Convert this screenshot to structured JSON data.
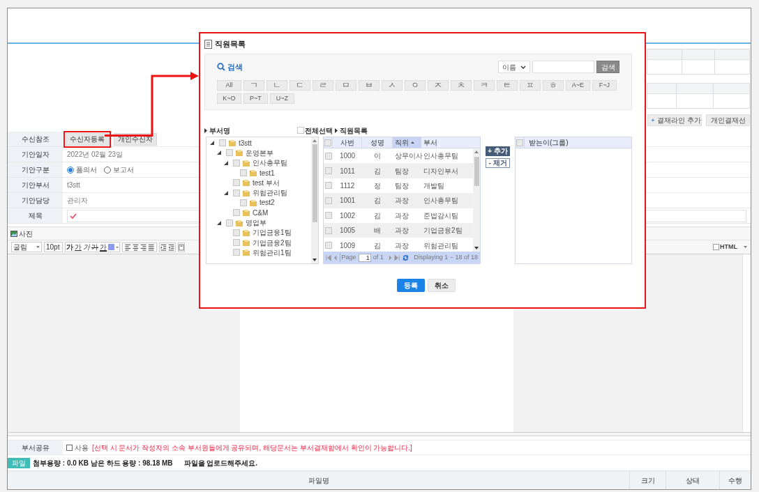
{
  "document": {
    "approval_buttons": [
      {
        "label": "결재라인 추가",
        "kind": "add"
      },
      {
        "label": "개인결재선",
        "kind": "plain"
      }
    ],
    "form_rows": [
      {
        "kind": "buttons",
        "label": "수신참조",
        "buttons": [
          {
            "label": "수신자등록",
            "highlighted": true
          },
          {
            "label": "개인수신자",
            "highlighted": false
          }
        ]
      },
      {
        "kind": "text",
        "label": "기안일자",
        "value": "2022년 02월 23일"
      },
      {
        "kind": "radio",
        "label": "기안구분",
        "options": [
          {
            "label": "품의서",
            "selected": true
          },
          {
            "label": "보고서",
            "selected": false
          }
        ]
      },
      {
        "kind": "text",
        "label": "기안부서",
        "value": "t3stt"
      },
      {
        "kind": "text",
        "label": "기안담당",
        "value": "관리자"
      },
      {
        "kind": "input",
        "label": "제목",
        "required": true
      }
    ],
    "editor": {
      "photo_button": "사진",
      "font": "굴림",
      "size": "10pt",
      "format_buttons": [
        {
          "label": "가",
          "kind": "bold"
        },
        {
          "label": "가",
          "kind": "underline"
        },
        {
          "label": "가",
          "kind": "italic"
        },
        {
          "label": "가",
          "kind": "strike"
        },
        {
          "label": "가",
          "kind": "color"
        }
      ],
      "html_label": "HTML",
      "html_checked": false
    },
    "share": {
      "label": "부서공유",
      "checkbox_label": "사용",
      "checked": false,
      "note": "[선택 시 문서가 작성자의 소속 부서원들에게 공유되며, 해당문서는 부서결재함에서 확인이 가능합니다.]"
    },
    "files": {
      "badge": "파일",
      "usage": "첨부용량 : 0.0 KB 남은 하드 용량 : 98.18 MB",
      "hint": "파일을 업로드해주세요.",
      "columns": [
        "파일명",
        "크기",
        "상태",
        "수행"
      ]
    }
  },
  "dialog": {
    "title": "직원목록",
    "search": {
      "heading": "검색",
      "field_select": "이름",
      "button": "검색"
    },
    "index_buttons": [
      "All",
      "ㄱ",
      "ㄴ",
      "ㄷ",
      "ㄹ",
      "ㅁ",
      "ㅂ",
      "ㅅ",
      "ㅇ",
      "ㅈ",
      "ㅊ",
      "ㅋ",
      "ㅌ",
      "ㅍ",
      "ㅎ",
      "A~E",
      "F~J",
      "K~O",
      "P~T",
      "U~Z"
    ],
    "tree_heading": "부서명",
    "select_all": {
      "label": "전체선택",
      "checked": false
    },
    "grid_heading": "직원목록",
    "tree": [
      {
        "label": "t3stt",
        "expanded": true,
        "checked": false,
        "children": [
          {
            "label": "운영본부",
            "expanded": true,
            "checked": false,
            "children": [
              {
                "label": "인사총무팀",
                "expanded": true,
                "checked": false,
                "children": [
                  {
                    "label": "test1",
                    "checked": false
                  }
                ]
              },
              {
                "label": "test 부서",
                "checked": false
              },
              {
                "label": "위험관리팀",
                "expanded": true,
                "checked": false,
                "children": [
                  {
                    "label": "test2",
                    "checked": false
                  }
                ]
              },
              {
                "label": "C&M",
                "checked": false
              }
            ]
          },
          {
            "label": "영업부",
            "expanded": true,
            "checked": false,
            "children": [
              {
                "label": "기업금융1팀",
                "checked": false
              },
              {
                "label": "기업금융2팀",
                "checked": false
              },
              {
                "label": "위험관리1팀",
                "checked": false
              }
            ]
          }
        ]
      }
    ],
    "grid": {
      "all_checked": false,
      "columns": [
        {
          "label": "사번",
          "sorted": false
        },
        {
          "label": "성명",
          "sorted": false
        },
        {
          "label": "직위",
          "sorted": true
        },
        {
          "label": "부서",
          "sorted": false
        }
      ],
      "rows": [
        {
          "cells": [
            "1000",
            "이",
            "상무이사",
            "인사총무팀"
          ],
          "checked": false
        },
        {
          "cells": [
            "1011",
            "김",
            "팀장",
            "디자인부서"
          ],
          "checked": false
        },
        {
          "cells": [
            "1112",
            "정",
            "팀장",
            "개발팀"
          ],
          "checked": false
        },
        {
          "cells": [
            "1001",
            "김",
            "과장",
            "인사총무팀"
          ],
          "checked": false
        },
        {
          "cells": [
            "1002",
            "김",
            "과장",
            "준법감시팀"
          ],
          "checked": false
        },
        {
          "cells": [
            "1005",
            "배",
            "과장",
            "기업금융2팀"
          ],
          "checked": false
        },
        {
          "cells": [
            "1009",
            "김",
            "과장",
            "위험관리팀"
          ],
          "checked": false
        }
      ],
      "pager": {
        "page_label": "Page",
        "page": "1",
        "of": "of 1",
        "summary": "Displaying 1 − 18 of 18"
      }
    },
    "move_buttons": [
      {
        "label": "+ 추가",
        "kind": "add"
      },
      {
        "label": "- 제거",
        "kind": "remove"
      }
    ],
    "recipients": {
      "heading": "받는이(그룹)",
      "checked": false
    },
    "actions": [
      {
        "label": "등록",
        "kind": "primary"
      },
      {
        "label": "취소",
        "kind": "secondary"
      }
    ]
  }
}
